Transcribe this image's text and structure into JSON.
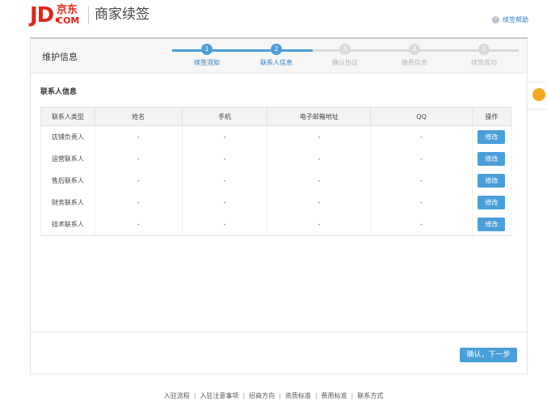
{
  "header": {
    "logo_jd": "JD.",
    "logo_cn": "京东",
    "logo_com": "COM",
    "title": "商家续签",
    "help_label": "续签帮助",
    "help_icon": "?"
  },
  "panel": {
    "title": "维护信息",
    "steps": [
      {
        "number": "1",
        "label": "续签须知",
        "state": "active"
      },
      {
        "number": "2",
        "label": "联系人信息",
        "state": "active"
      },
      {
        "number": "3",
        "label": "确认协议",
        "state": "inactive"
      },
      {
        "number": "4",
        "label": "缴费信息",
        "state": "inactive"
      },
      {
        "number": "5",
        "label": "续签成功",
        "state": "inactive"
      }
    ],
    "section_title": "联系人信息",
    "table": {
      "headers": [
        "联系人类型",
        "姓名",
        "手机",
        "电子邮箱地址",
        "QQ",
        "操作"
      ],
      "rows": [
        {
          "type": "店铺负责人",
          "name": "-",
          "phone": "-",
          "email": "-",
          "qq": "-",
          "action": "修改"
        },
        {
          "type": "运营联系人",
          "name": "-",
          "phone": "-",
          "email": "-",
          "qq": "-",
          "action": "修改"
        },
        {
          "type": "售后联系人",
          "name": "-",
          "phone": "-",
          "email": "-",
          "qq": "-",
          "action": "修改"
        },
        {
          "type": "财务联系人",
          "name": "-",
          "phone": "-",
          "email": "-",
          "qq": "-",
          "action": "修改"
        },
        {
          "type": "技术联系人",
          "name": "-",
          "phone": "-",
          "email": "-",
          "qq": "-",
          "action": "修改"
        }
      ]
    },
    "next_button": "确认，下一步"
  },
  "footer": {
    "links": [
      "入驻流程",
      "入驻注意事项",
      "招商方向",
      "资质标准",
      "费用标准",
      "联系方式"
    ],
    "separator": "|"
  },
  "colors": {
    "brand_red": "#e1251b",
    "accent_blue": "#4a9fd8",
    "inactive_gray": "#d9d9d9",
    "float_orange": "#f5a623"
  }
}
